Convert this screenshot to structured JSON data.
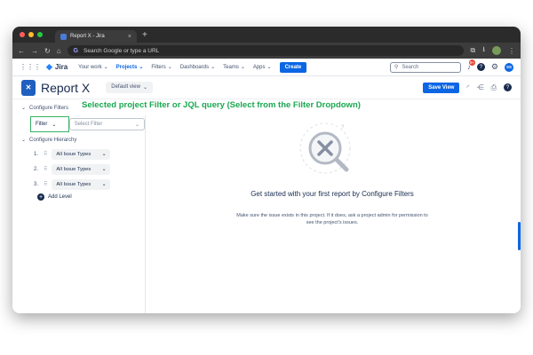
{
  "browser": {
    "tab_title": "Report X - Jira",
    "tab_close": "×",
    "new_tab": "+",
    "omnibox_placeholder": "Search Google or type a URL",
    "colors": {
      "close": "#ff5f57",
      "min": "#febc2e",
      "max": "#28c840"
    }
  },
  "nav": {
    "product": "Jira",
    "items": [
      {
        "label": "Your work",
        "active": false
      },
      {
        "label": "Projects",
        "active": true
      },
      {
        "label": "Filters",
        "active": false
      },
      {
        "label": "Dashboards",
        "active": false
      },
      {
        "label": "Teams",
        "active": false
      },
      {
        "label": "Apps",
        "active": false
      }
    ],
    "create_label": "Create",
    "search_placeholder": "Search",
    "notification_count": "9+",
    "user_initials": "SS"
  },
  "header": {
    "title": "Report X",
    "view_selector": "Default view",
    "save_view_label": "Save View"
  },
  "annotation": "Selected project Filter or JQL query (Select from the Filter Dropdown)",
  "sidebar": {
    "configure_filters": "Configure Filters",
    "filter_dropdown": "Filter",
    "filter_input_placeholder": "Select Filter",
    "configure_hierarchy": "Configure Hierarchy",
    "levels": [
      {
        "number": "1.",
        "value": "All Issue Types"
      },
      {
        "number": "2.",
        "value": "All Issue Types"
      },
      {
        "number": "3.",
        "value": "All Issue Types"
      }
    ],
    "add_level": "Add Level"
  },
  "empty_state": {
    "title": "Get started with your first report by Configure Filters",
    "description": "Make sure the issue exists in this project. If it does, ask a project admin for permission to see the project's issues."
  }
}
